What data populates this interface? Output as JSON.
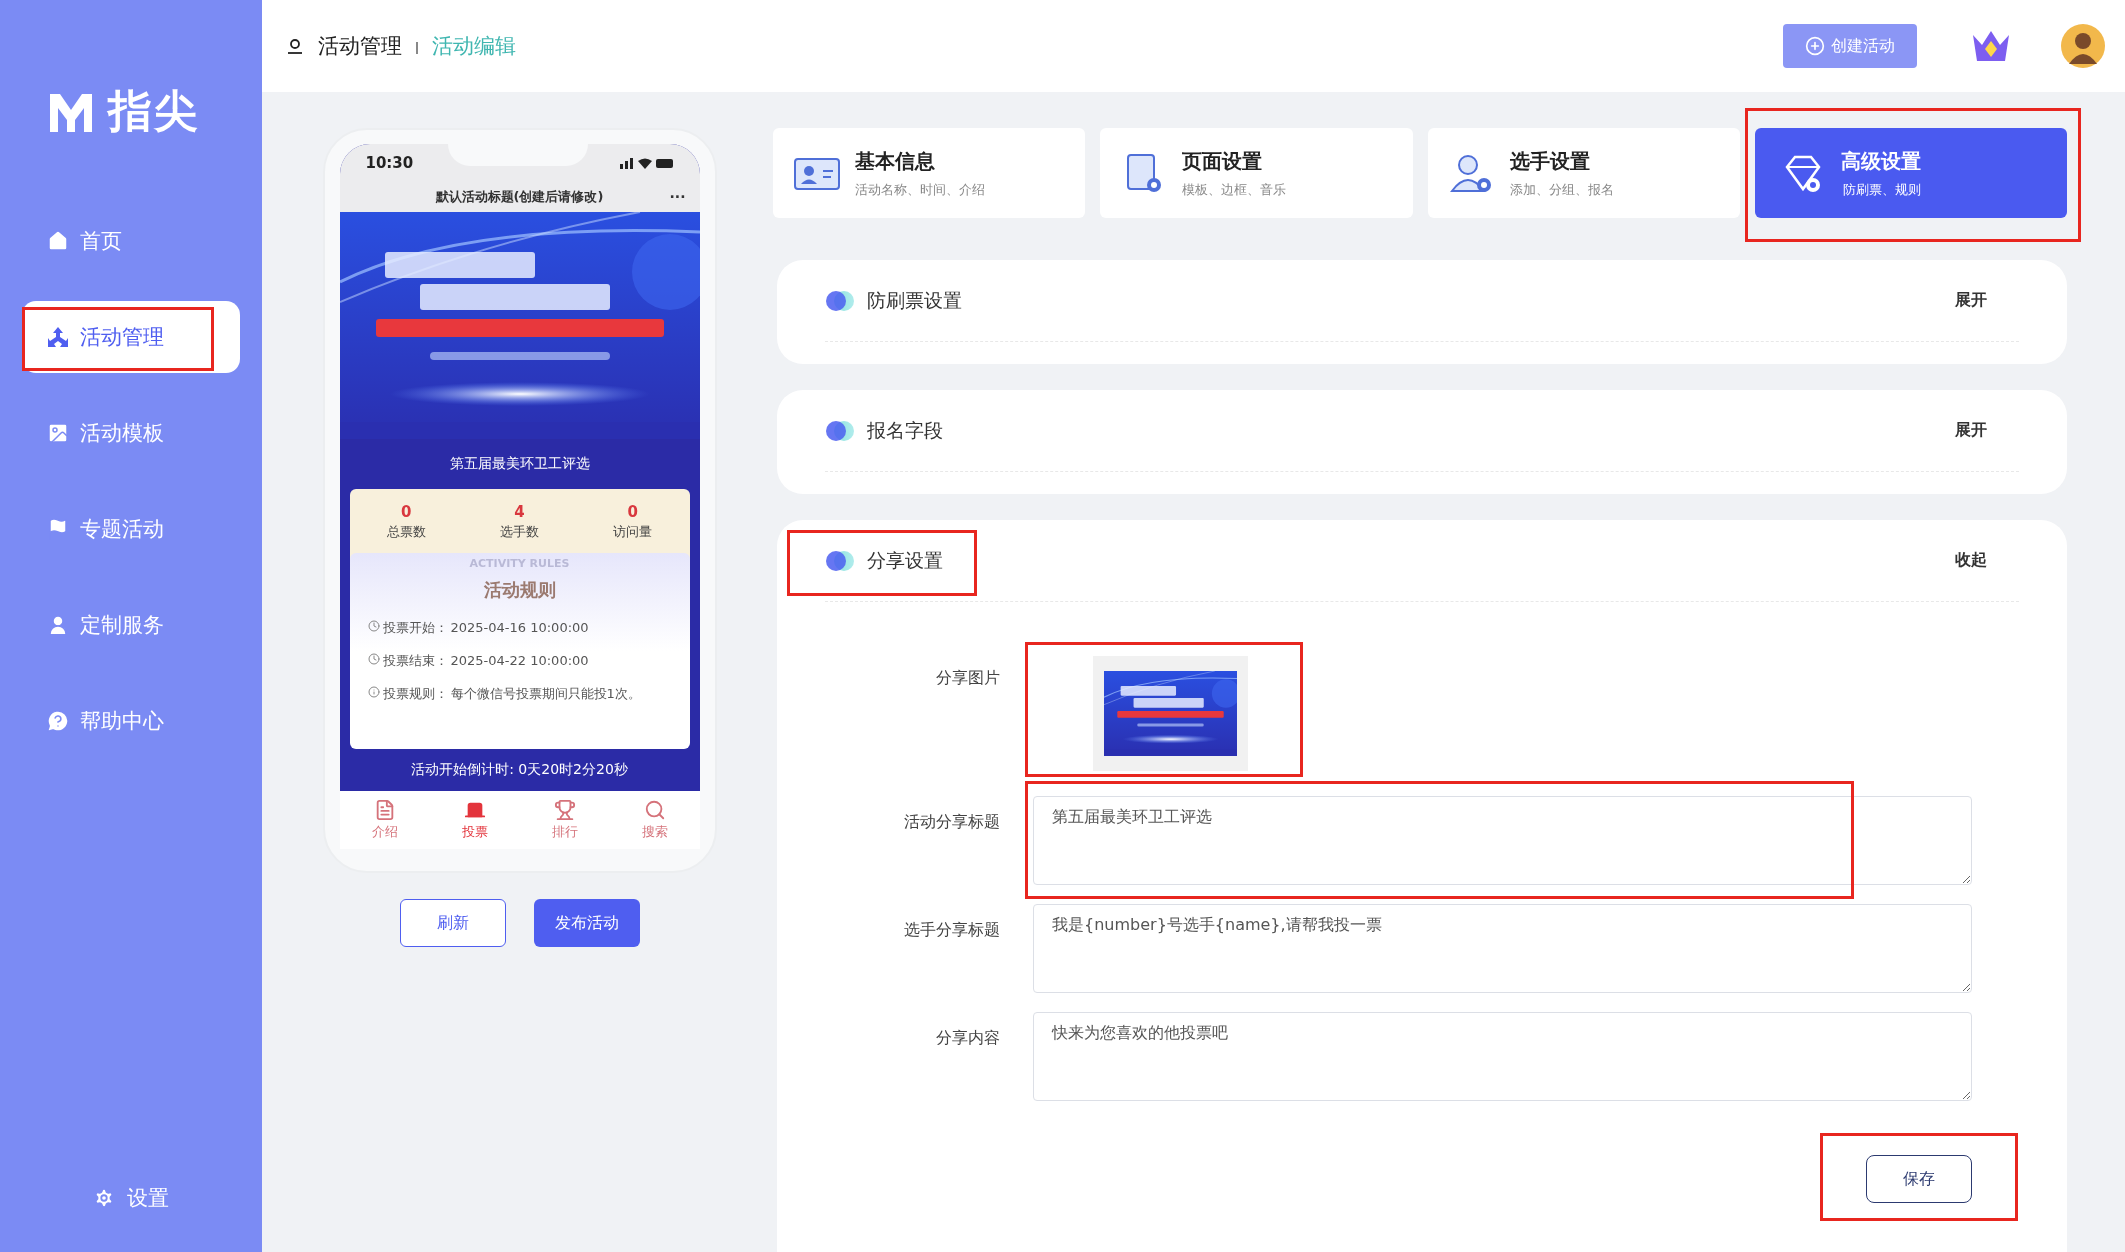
{
  "sidebar": {
    "logo": "指尖",
    "items": [
      {
        "label": "首页",
        "selected": false,
        "annotated": false
      },
      {
        "label": "活动管理",
        "selected": true,
        "annotated": true
      },
      {
        "label": "活动模板",
        "selected": false,
        "annotated": false
      },
      {
        "label": "专题活动",
        "selected": false,
        "annotated": false
      },
      {
        "label": "定制服务",
        "selected": false,
        "annotated": false
      },
      {
        "label": "帮助中心",
        "selected": false,
        "annotated": false
      }
    ],
    "settings": "设置"
  },
  "header": {
    "breadcrumb": [
      "活动管理",
      "活动编辑"
    ],
    "create_button": "创建活动"
  },
  "phone": {
    "time": "10:30",
    "title": "默认活动标题(创建后请修改)",
    "more": "···",
    "subtitle": "第五届最美环卫工评选",
    "stats": [
      {
        "value": "0",
        "label": "总票数"
      },
      {
        "value": "4",
        "label": "选手数"
      },
      {
        "value": "0",
        "label": "访问量"
      }
    ],
    "rules_watermark": "ACTIVITY RULES",
    "rules_title": "活动规则",
    "rules": [
      {
        "label": "投票开始：",
        "value": "2025-04-16 10:00:00"
      },
      {
        "label": "投票结束：",
        "value": "2025-04-22 10:00:00"
      },
      {
        "label": "投票规则：",
        "value": "每个微信号投票期间只能投1次。"
      }
    ],
    "countdown": "活动开始倒计时: 0天20时2分20秒",
    "nav": [
      {
        "label": "介绍",
        "selected": false
      },
      {
        "label": "投票",
        "selected": true
      },
      {
        "label": "排行",
        "selected": false
      },
      {
        "label": "搜索",
        "selected": false
      }
    ]
  },
  "preview_buttons": [
    {
      "label": "刷新",
      "kind": "outline"
    },
    {
      "label": "发布活动",
      "kind": "primary"
    }
  ],
  "tabs": [
    {
      "title": "基本信息",
      "subtitle": "活动名称、时间、介绍",
      "selected": false,
      "annotated": false
    },
    {
      "title": "页面设置",
      "subtitle": "模板、边框、音乐",
      "selected": false,
      "annotated": false
    },
    {
      "title": "选手设置",
      "subtitle": "添加、分组、报名",
      "selected": false,
      "annotated": false
    },
    {
      "title": "高级设置",
      "subtitle": "防刷票、规则",
      "selected": true,
      "annotated": true
    }
  ],
  "sections": [
    {
      "title": "防刷票设置",
      "toggle": "展开",
      "expanded": false,
      "annotated": false
    },
    {
      "title": "报名字段",
      "toggle": "展开",
      "expanded": false,
      "annotated": false
    },
    {
      "title": "分享设置",
      "toggle": "收起",
      "expanded": true,
      "annotated": true,
      "form": {
        "image_label": "分享图片",
        "image_annotated": true,
        "fields": [
          {
            "label": "活动分享标题",
            "value": "第五届最美环卫工评选",
            "annotated": true
          },
          {
            "label": "选手分享标题",
            "value": "我是{number}号选手{name},请帮我投一票",
            "annotated": false
          },
          {
            "label": "分享内容",
            "value": "快来为您喜欢的他投票吧",
            "annotated": false
          }
        ],
        "save_button": "保存",
        "save_annotated": true
      }
    }
  ]
}
